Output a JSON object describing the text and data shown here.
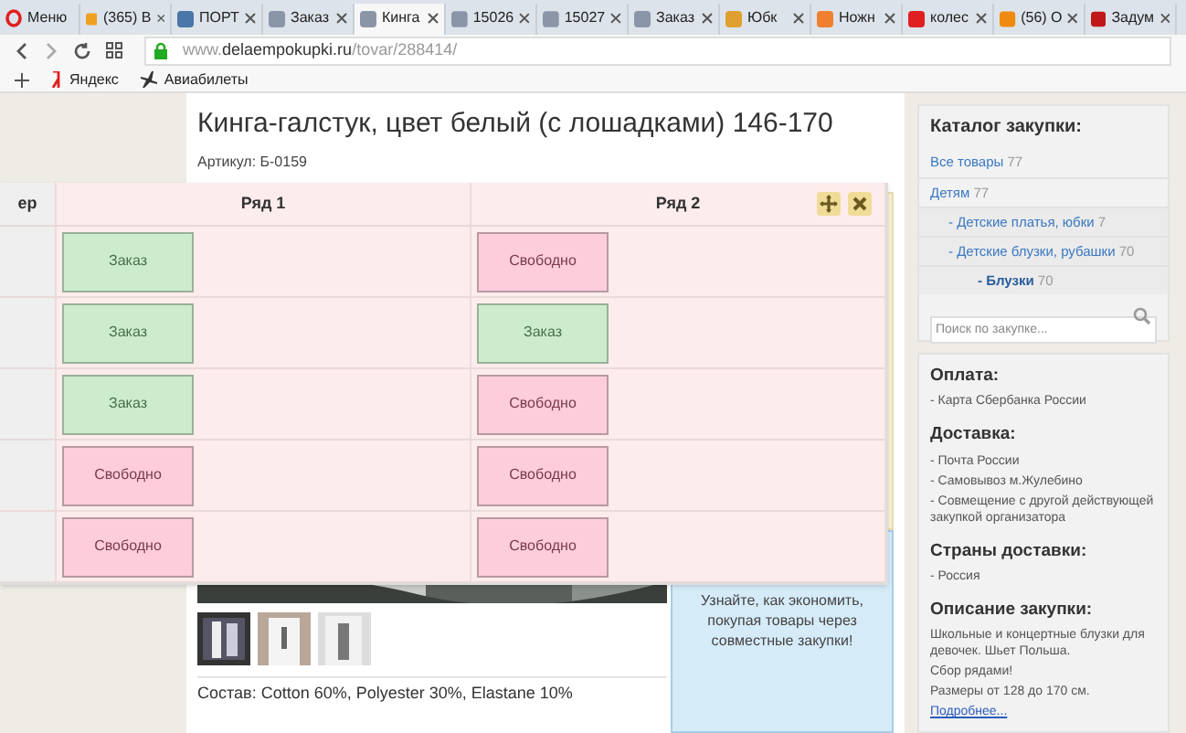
{
  "browser": {
    "tabs": [
      {
        "label": "Меню",
        "kind": "menu",
        "selected": false
      },
      {
        "label": "(365) В",
        "kind": "tab",
        "color": "#f0a020",
        "selected": false
      },
      {
        "label": "ПОРТ",
        "kind": "tab",
        "color": "#4a76a8",
        "selected": false
      },
      {
        "label": "Заказ",
        "kind": "tab",
        "color": "#8a96a8",
        "selected": false
      },
      {
        "label": "Кинга",
        "kind": "tab",
        "color": "#8a96a8",
        "selected": true
      },
      {
        "label": "15026",
        "kind": "tab",
        "color": "#8a96a8",
        "selected": false
      },
      {
        "label": "15027",
        "kind": "tab",
        "color": "#8a96a8",
        "selected": false
      },
      {
        "label": "Заказ",
        "kind": "tab",
        "color": "#8a96a8",
        "selected": false
      },
      {
        "label": "Юбк",
        "kind": "tab",
        "color": "#e0a030",
        "selected": false
      },
      {
        "label": "Ножн",
        "kind": "tab",
        "color": "#f08030",
        "selected": false
      },
      {
        "label": "колес",
        "kind": "tab",
        "color": "#e02020",
        "selected": false
      },
      {
        "label": "(56) О",
        "kind": "tab",
        "color": "#f08a10",
        "selected": false
      },
      {
        "label": "Задум",
        "kind": "tab",
        "color": "#c01818",
        "selected": false
      }
    ],
    "url": {
      "prefix": "www.",
      "host": "delaempokupki.ru",
      "path": "/tovar/288414/"
    },
    "bookmarks": [
      "Яндекс",
      "Авиабилеты"
    ]
  },
  "product": {
    "title": "Кинга-галстук, цвет белый (с лошадками) 146-170",
    "sku": "Артикул: Б-0159",
    "promo": "Узнайте, как экономить, покупая товары через совместные закупки!",
    "composition": "Состав: Cotton 60%, Polyester 30%, Elastane 10%"
  },
  "sidebar": {
    "catalog_title": "Каталог закупки:",
    "items": [
      {
        "label": "Все товары",
        "count": "77",
        "selected": false
      },
      {
        "label": "Детям",
        "count": "77",
        "selected": false,
        "children": [
          {
            "label": "- Детские платья, юбки",
            "count": "7",
            "selected": false
          },
          {
            "label": "- Детские блузки, рубашки",
            "count": "70",
            "selected": false,
            "children": [
              {
                "label": "- Блузки",
                "count": "70",
                "selected": true
              }
            ]
          }
        ]
      }
    ],
    "search": {
      "placeholder": "Поиск по закупке..."
    },
    "sections": [
      {
        "heading": "Оплата:",
        "lines": [
          "- Карта Сбербанка России"
        ]
      },
      {
        "heading": "Доставка:",
        "lines": [
          "- Почта России",
          "- Самовывоз м.Жулебино",
          "- Совмещение с другой действующей закупкой организатора"
        ]
      },
      {
        "heading": "Страны доставки:",
        "lines": [
          "- Россия"
        ]
      },
      {
        "heading": "Описание закупки:",
        "lines": [
          "Школьные и концертные блузки для девочек. Шьет Польша.",
          "Сбор рядами!",
          "Размеры от 128 до 170 см."
        ],
        "link": "Подробнее..."
      }
    ]
  },
  "seat_table": {
    "columns": [
      "ер",
      "Ряд 1",
      "Ряд 2"
    ],
    "rows": [
      {
        "cells": [
          {
            "label": "Заказ",
            "kind": "ordered"
          },
          {
            "label": "Свободно",
            "kind": "free"
          }
        ]
      },
      {
        "cells": [
          {
            "label": "Заказ",
            "kind": "ordered"
          },
          {
            "label": "Заказ",
            "kind": "ordered"
          }
        ]
      },
      {
        "cells": [
          {
            "label": "Заказ",
            "kind": "ordered"
          },
          {
            "label": "Свободно",
            "kind": "free"
          }
        ]
      },
      {
        "cells": [
          {
            "label": "Свободно",
            "kind": "free"
          },
          {
            "label": "Свободно",
            "kind": "free"
          }
        ]
      },
      {
        "cells": [
          {
            "label": "Свободно",
            "kind": "free"
          },
          {
            "label": "Свободно",
            "kind": "free"
          }
        ]
      }
    ]
  }
}
